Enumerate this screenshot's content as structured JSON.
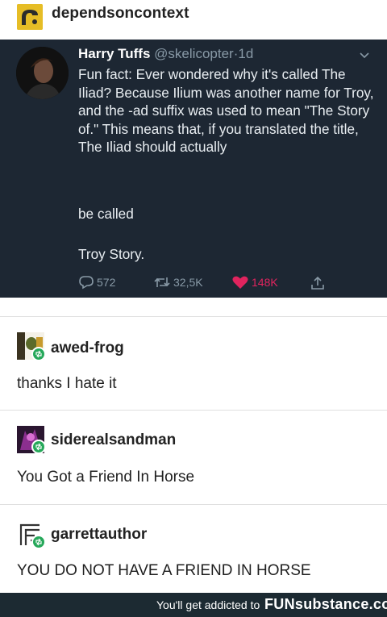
{
  "header": {
    "blog_name": "dependsoncontext",
    "avatar_icon": "tumblr-avatar-icon"
  },
  "tweet": {
    "author": "Harry Tuffs",
    "handle": "@skelicopter",
    "separator": "·",
    "time": "1d",
    "body": "Fun fact: Ever wondered why it's called The Iliad? Because Ilium was another name for Troy, and the -ad suffix was used to mean \"The Story of.\" This means that, if you translated the title, The Iliad should actually",
    "line2": "be called",
    "line3": "Troy Story.",
    "replies": "572",
    "retweets": "32,5K",
    "likes": "148K",
    "colors": {
      "background": "#1d2733",
      "like": "#e0245e",
      "muted": "#8899a6"
    }
  },
  "reblogs": [
    {
      "username": "awed-frog",
      "text": "thanks I hate it"
    },
    {
      "username": "siderealsandman",
      "text": "You Got a Friend In Horse"
    },
    {
      "username": "garrettauthor",
      "text": "YOU DO NOT HAVE A FRIEND IN HORSE"
    }
  ],
  "footer": {
    "tagline": "You'll get addicted to",
    "brand": "FUNsubstance.com"
  }
}
